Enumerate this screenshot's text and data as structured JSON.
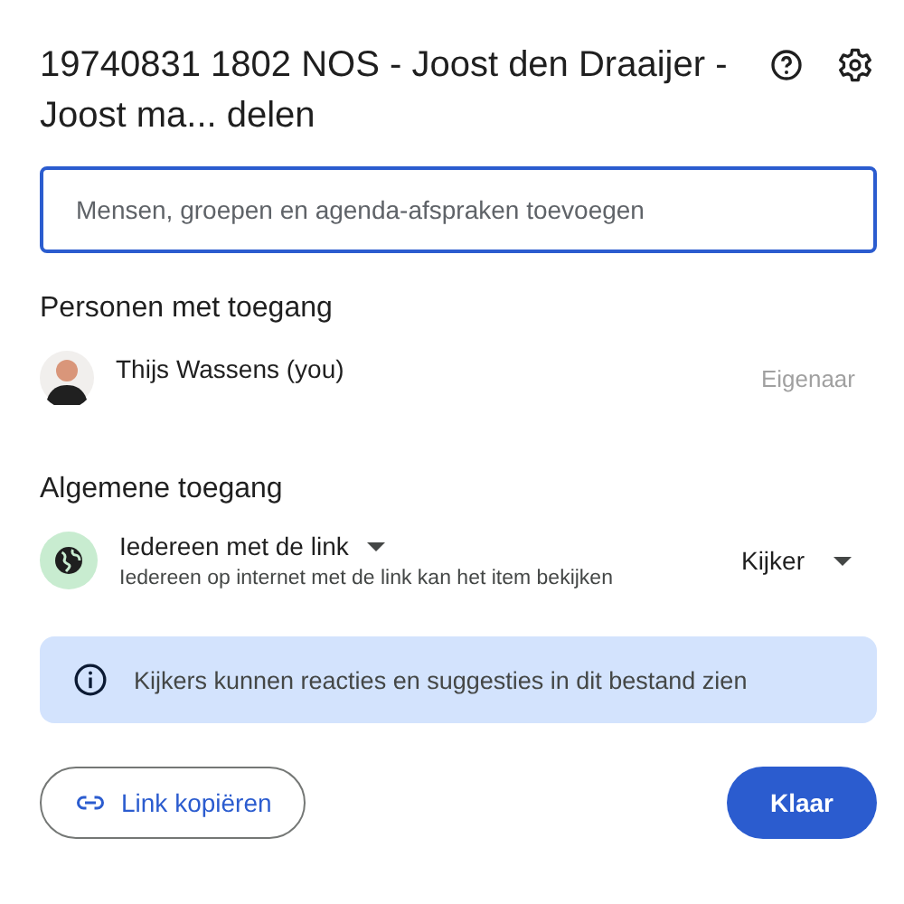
{
  "dialog": {
    "title": "19740831 1802 NOS - Joost den Draaijer - Joost ma... delen"
  },
  "search": {
    "placeholder": "Mensen, groepen en agenda-afspraken toevoegen"
  },
  "people_section": {
    "heading": "Personen met toegang"
  },
  "people": [
    {
      "name": "Thijs Wassens (you)",
      "role": "Eigenaar"
    }
  ],
  "general_access": {
    "heading": "Algemene toegang",
    "scope": "Iedereen met de link",
    "description": "Iedereen op internet met de link kan het item bekijken",
    "role": "Kijker"
  },
  "info_banner": {
    "text": "Kijkers kunnen reacties en suggesties in dit bestand zien"
  },
  "buttons": [
    {
      "label": "Link kopiëren",
      "kind": "outlined"
    },
    {
      "label": "Klaar",
      "kind": "filled"
    }
  ]
}
